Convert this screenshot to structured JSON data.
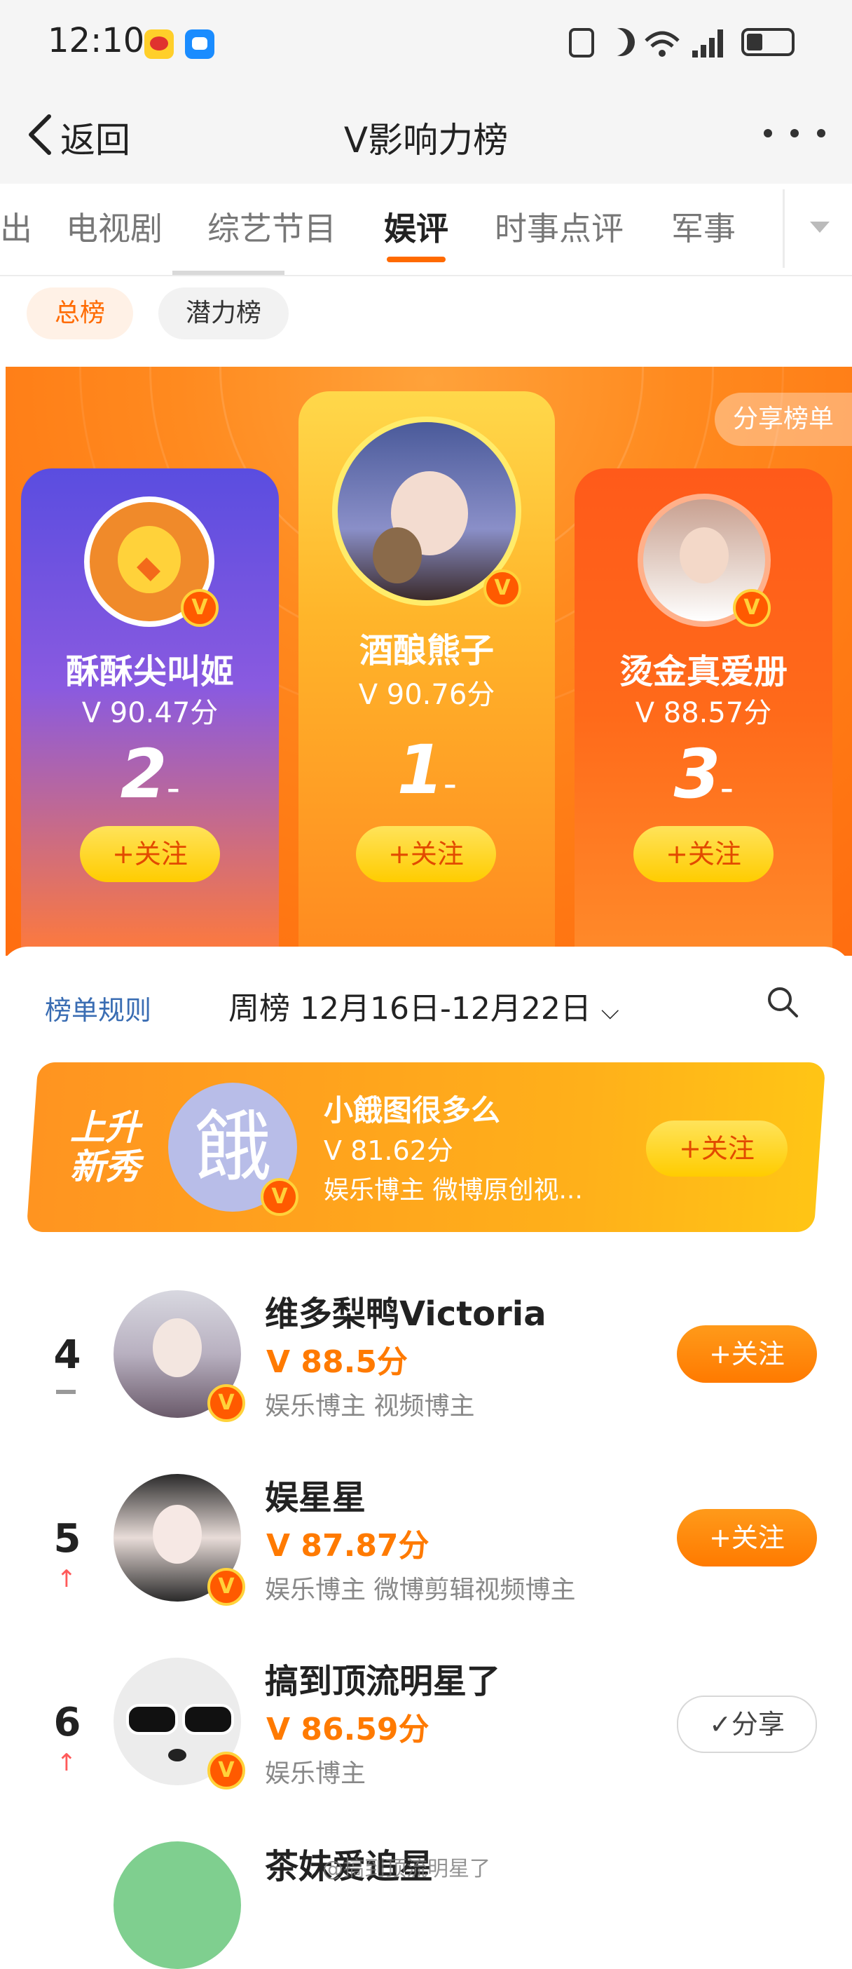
{
  "status_bar": {
    "time": "12:10",
    "signal_label": "6"
  },
  "nav": {
    "back_label": "返回",
    "title": "V影响力榜",
    "more_icon": "more-dots-icon"
  },
  "tabs": [
    {
      "label": "出"
    },
    {
      "label": "电视剧"
    },
    {
      "label": "综艺节目"
    },
    {
      "label": "娱评",
      "active": true
    },
    {
      "label": "时事点评"
    },
    {
      "label": "军事"
    }
  ],
  "sub_tabs": [
    {
      "label": "总榜",
      "active": true
    },
    {
      "label": "潜力榜"
    }
  ],
  "hero": {
    "share_label": "分享榜单",
    "top3": [
      {
        "rank": "2",
        "name": "酥酥尖叫姬",
        "score": "90.47分",
        "follow": "+关注"
      },
      {
        "rank": "1",
        "name": "酒酿熊子",
        "score": "90.76分",
        "follow": "+关注"
      },
      {
        "rank": "3",
        "name": "烫金真爱册",
        "score": "88.57分",
        "follow": "+关注"
      }
    ],
    "rank_change": "–"
  },
  "panel": {
    "rules_label": "榜单规则",
    "period_label": "周榜 12月16日-12月22日"
  },
  "rising": {
    "tag_line1": "上升",
    "tag_line2": "新秀",
    "avatar_char": "餓",
    "name": "小餓图很多么",
    "score": "81.62分",
    "desc": "娱乐博主 微博原创视...",
    "follow": "+关注"
  },
  "list": [
    {
      "rank": "4",
      "trend": "–",
      "name": "维多梨鸭Victoria",
      "score": "88.5分",
      "desc": "娱乐博主 视频博主",
      "action": "+关注"
    },
    {
      "rank": "5",
      "trend": "↑",
      "name": "娱星星",
      "score": "87.87分",
      "desc": "娱乐博主 微博剪辑视频博主",
      "action": "+关注"
    },
    {
      "rank": "6",
      "trend": "↑",
      "name": "搞到顶流明星了",
      "score": "86.59分",
      "desc": "娱乐博主",
      "action": "✓分享"
    },
    {
      "name": "茶妹爱追星"
    }
  ],
  "watermark": "@搞到顶流明星了",
  "colors": {
    "accent": "#ff6a00",
    "score": "#ff7a00",
    "follow_yellow": "#ffcc00",
    "link": "#3a6db3"
  }
}
